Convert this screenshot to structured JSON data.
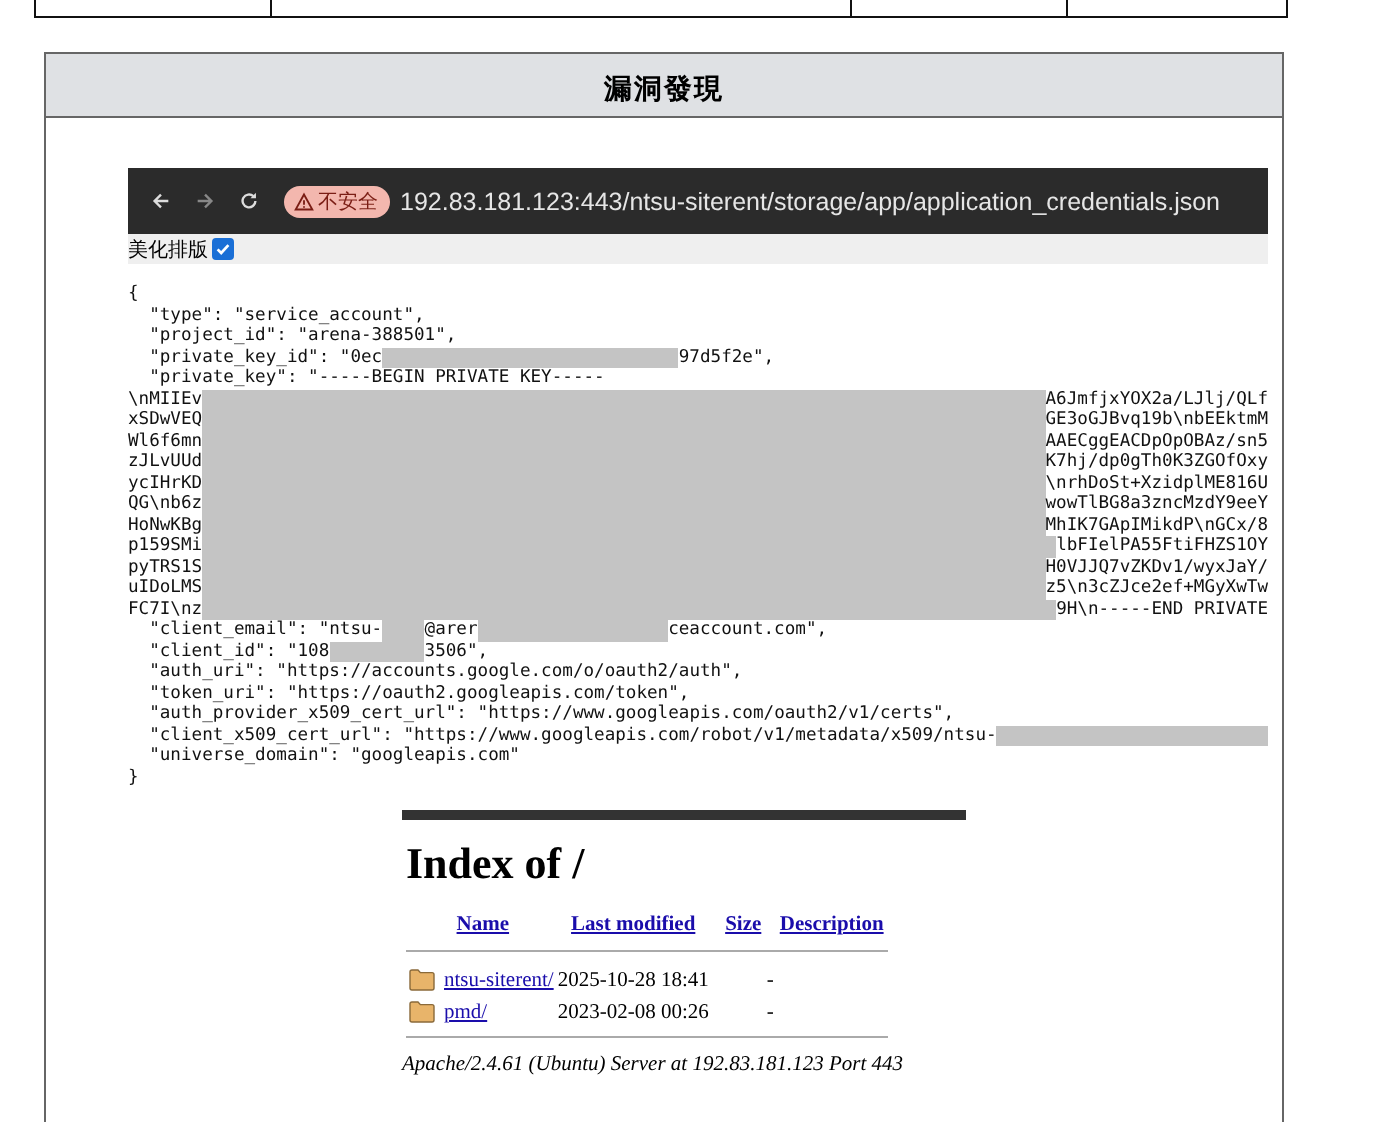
{
  "section": {
    "title": "漏洞發現"
  },
  "browser": {
    "security_badge": "不安全",
    "url": "192.83.181.123:443/ntsu-siterent/storage/app/application_credentials.json",
    "pretty_print": {
      "label": "美化排版",
      "checked": true
    }
  },
  "code_lines": [
    {
      "parts": [
        {
          "kind": "text",
          "text": "{"
        }
      ]
    },
    {
      "parts": [
        {
          "kind": "text",
          "text": "  \"type\": \"service_account\","
        }
      ]
    },
    {
      "parts": [
        {
          "kind": "text",
          "text": "  \"project_id\": \"arena-388501\","
        }
      ]
    },
    {
      "parts": [
        {
          "kind": "text",
          "text": "  \"private_key_id\": \"0ec"
        },
        {
          "kind": "redaction"
        },
        {
          "kind": "text",
          "text": "97d5f2e\","
        }
      ]
    },
    {
      "parts": [
        {
          "kind": "text",
          "text": "  \"private_key\": \"-----BEGIN PRIVATE KEY-----"
        }
      ]
    },
    {
      "parts": [
        {
          "kind": "text",
          "text": "\\nMIIEv"
        },
        {
          "kind": "redaction"
        },
        {
          "kind": "text",
          "text": "A6JmfjxYOX2a/LJlj/QLf"
        }
      ]
    },
    {
      "parts": [
        {
          "kind": "text",
          "text": "xSDwVEQ"
        },
        {
          "kind": "redaction"
        },
        {
          "kind": "text",
          "text": "GE3oGJBvq19b\\nbEEktmM"
        }
      ]
    },
    {
      "parts": [
        {
          "kind": "text",
          "text": "Wl6f6mn"
        },
        {
          "kind": "redaction"
        },
        {
          "kind": "text",
          "text": "AAECggEACDpOpOBAz/sn5"
        }
      ]
    },
    {
      "parts": [
        {
          "kind": "text",
          "text": "zJLvUUd"
        },
        {
          "kind": "redaction"
        },
        {
          "kind": "text",
          "text": "K7hj/dp0gTh0K3ZGOfOxy"
        }
      ]
    },
    {
      "parts": [
        {
          "kind": "text",
          "text": "ycIHrKD"
        },
        {
          "kind": "redaction"
        },
        {
          "kind": "text",
          "text": "\\nrhDoSt+XzidplME816U"
        }
      ]
    },
    {
      "parts": [
        {
          "kind": "text",
          "text": "QG\\nb6z"
        },
        {
          "kind": "redaction"
        },
        {
          "kind": "text",
          "text": "wowTlBG8a3zncMzdY9eeY"
        }
      ]
    },
    {
      "parts": [
        {
          "kind": "text",
          "text": "HoNwKBg"
        },
        {
          "kind": "redaction"
        },
        {
          "kind": "text",
          "text": "MhIK7GApIMikdP\\nGCx/8"
        }
      ]
    },
    {
      "parts": [
        {
          "kind": "text",
          "text": "p159SMi"
        },
        {
          "kind": "redaction"
        },
        {
          "kind": "text",
          "text": "lbFIelPA55FtiFHZS1OY"
        }
      ]
    },
    {
      "parts": [
        {
          "kind": "text",
          "text": "pyTRS1S"
        },
        {
          "kind": "redaction"
        },
        {
          "kind": "text",
          "text": "H0VJJQ7vZKDv1/wyxJaY/"
        }
      ]
    },
    {
      "parts": [
        {
          "kind": "text",
          "text": "uIDoLMS"
        },
        {
          "kind": "redaction"
        },
        {
          "kind": "text",
          "text": "z5\\n3cZJce2ef+MGyXwTw"
        }
      ]
    },
    {
      "parts": [
        {
          "kind": "text",
          "text": "FC7I\\nz"
        },
        {
          "kind": "redaction"
        },
        {
          "kind": "text",
          "text": "9H\\n-----END PRIVATE"
        }
      ]
    },
    {
      "parts": [
        {
          "kind": "text",
          "text": "  \"client_email\": \"ntsu-"
        },
        {
          "kind": "redaction"
        },
        {
          "kind": "text",
          "text": "@arer"
        },
        {
          "kind": "redaction"
        },
        {
          "kind": "text",
          "text": "ceaccount.com\","
        }
      ]
    },
    {
      "parts": [
        {
          "kind": "text",
          "text": "  \"client_id\": \"108"
        },
        {
          "kind": "redaction"
        },
        {
          "kind": "text",
          "text": "3506\","
        }
      ]
    },
    {
      "parts": [
        {
          "kind": "text",
          "text": "  \"auth_uri\": \"https://accounts.google.com/o/oauth2/auth\","
        }
      ]
    },
    {
      "parts": [
        {
          "kind": "text",
          "text": "  \"token_uri\": \"https://oauth2.googleapis.com/token\","
        }
      ]
    },
    {
      "parts": [
        {
          "kind": "text",
          "text": "  \"auth_provider_x509_cert_url\": \"https://www.googleapis.com/oauth2/v1/certs\","
        }
      ]
    },
    {
      "parts": [
        {
          "kind": "text",
          "text": "  \"client_x509_cert_url\": \"https://www.googleapis.com/robot/v1/metadata/x509/ntsu-"
        },
        {
          "kind": "redaction"
        }
      ]
    },
    {
      "parts": [
        {
          "kind": "text",
          "text": "  \"universe_domain\": \"googleapis.com\""
        }
      ]
    },
    {
      "parts": [
        {
          "kind": "text",
          "text": "}"
        }
      ]
    }
  ],
  "index_page": {
    "title": "Index of /",
    "columns": [
      "Name",
      "Last modified",
      "Size",
      "Description"
    ],
    "rows": [
      {
        "name": "ntsu-siterent/",
        "modified": "2025-10-28 18:41",
        "size": "-"
      },
      {
        "name": "pmd/",
        "modified": "2023-02-08 00:26",
        "size": "-"
      }
    ],
    "footer": "Apache/2.4.61 (Ubuntu) Server at 192.83.181.123 Port 443"
  }
}
